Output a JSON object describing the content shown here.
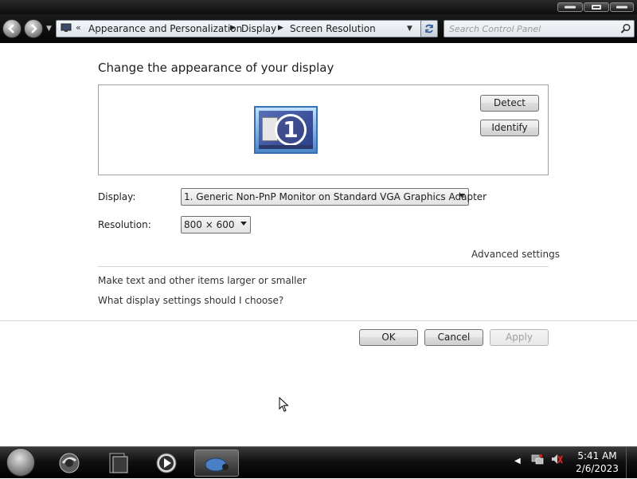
{
  "navbar": {
    "breadcrumb": [
      "Appearance and Personalization",
      "Display",
      "Screen Resolution"
    ],
    "search_placeholder": "Search Control Panel"
  },
  "content": {
    "heading": "Change the appearance of your display",
    "monitor_number": "1",
    "detect_label": "Detect",
    "identify_label": "Identify",
    "display_label": "Display:",
    "display_value": "1. Generic Non-PnP Monitor on Standard VGA Graphics Adapter",
    "resolution_label": "Resolution:",
    "resolution_value": "800 × 600",
    "advanced_settings": "Advanced settings",
    "link_text_size": "Make text and other items larger or smaller",
    "link_help": "What display settings should I choose?",
    "ok_label": "OK",
    "cancel_label": "Cancel",
    "apply_label": "Apply"
  },
  "taskbar": {
    "time": "5:41 AM",
    "date": "2/6/2023"
  }
}
